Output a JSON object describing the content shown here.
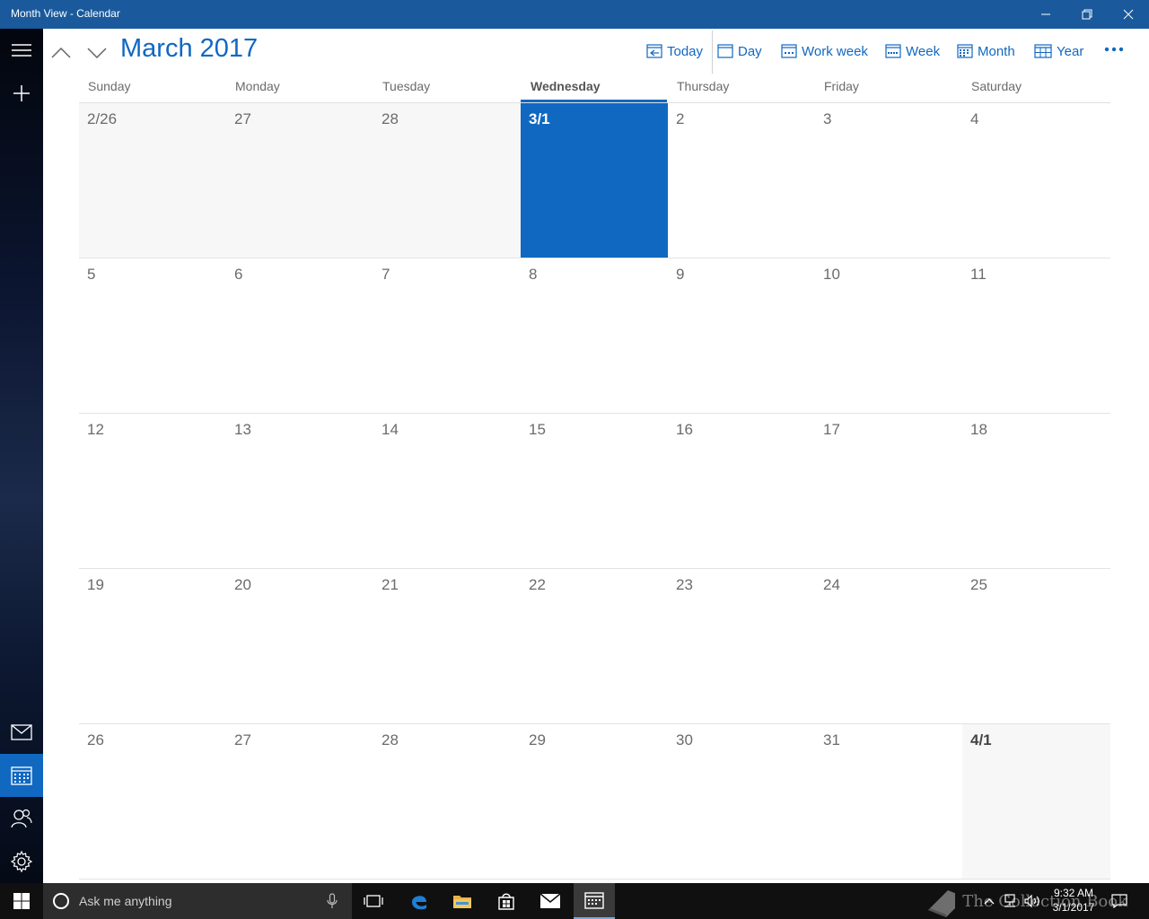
{
  "window": {
    "title": "Month View - Calendar"
  },
  "header": {
    "month_title": "March 2017",
    "commands": {
      "today": "Today",
      "day": "Day",
      "work_week": "Work week",
      "week": "Week",
      "month": "Month",
      "year": "Year"
    }
  },
  "weekdays": [
    "Sunday",
    "Monday",
    "Tuesday",
    "Wednesday",
    "Thursday",
    "Friday",
    "Saturday"
  ],
  "weeks": [
    [
      "2/26",
      "27",
      "28",
      "3/1",
      "2",
      "3",
      "4"
    ],
    [
      "5",
      "6",
      "7",
      "8",
      "9",
      "10",
      "11"
    ],
    [
      "12",
      "13",
      "14",
      "15",
      "16",
      "17",
      "18"
    ],
    [
      "19",
      "20",
      "21",
      "22",
      "23",
      "24",
      "25"
    ],
    [
      "26",
      "27",
      "28",
      "29",
      "30",
      "31",
      "4/1"
    ]
  ],
  "taskbar": {
    "search_placeholder": "Ask me anything",
    "time": "9:32 AM",
    "date": "3/1/2017"
  },
  "watermark": "The Collection Book",
  "colors": {
    "accent": "#1068c1",
    "titlebar": "#1a5a9c",
    "taskbar": "#101010"
  }
}
